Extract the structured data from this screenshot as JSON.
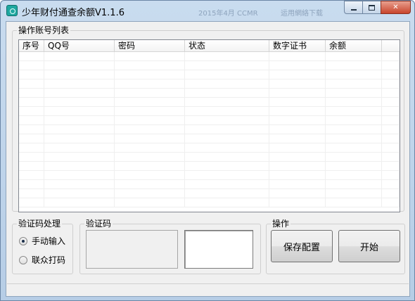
{
  "window": {
    "title": "少年财付通查余额V1.1.6",
    "ghost_text_1": "2015年4月 CCMR",
    "ghost_text_2": "运用網絡下载"
  },
  "accounts": {
    "group_label": "操作账号列表",
    "columns": [
      "序号",
      "QQ号",
      "密码",
      "状态",
      "数字证书",
      "余额"
    ],
    "rows": []
  },
  "captcha_mode": {
    "group_label": "验证码处理",
    "options": [
      {
        "label": "手动输入",
        "selected": true
      },
      {
        "label": "联众打码",
        "selected": false
      }
    ]
  },
  "captcha": {
    "group_label": "验证码",
    "input_value": ""
  },
  "actions": {
    "group_label": "操作",
    "save_label": "保存配置",
    "start_label": "开始"
  },
  "status_text": ""
}
